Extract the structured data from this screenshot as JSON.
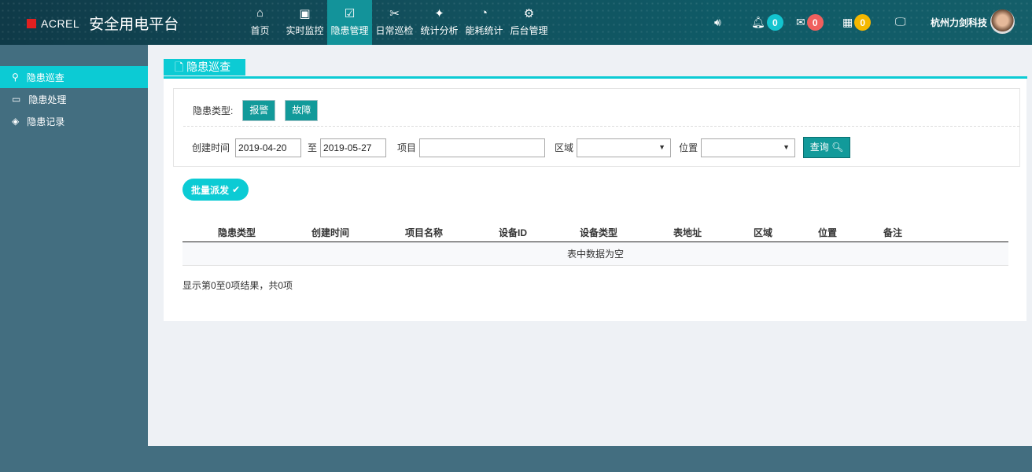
{
  "header": {
    "brand": "ACREL",
    "title": "安全用电平台",
    "nav": [
      {
        "label": "首页",
        "icon": "⌂"
      },
      {
        "label": "实时监控",
        "icon": "▣"
      },
      {
        "label": "隐患管理",
        "icon": "☑",
        "active": true
      },
      {
        "label": "日常巡检",
        "icon": "✂"
      },
      {
        "label": "统计分析",
        "icon": "✦"
      },
      {
        "label": "能耗统计",
        "icon": "◔"
      },
      {
        "label": "后台管理",
        "icon": "⚙"
      }
    ],
    "badges": {
      "bell": "0",
      "mail": "0",
      "calc": "0"
    },
    "badge_colors": {
      "bell": "#13c4cf",
      "mail": "#f0605e",
      "calc": "#f5b800"
    },
    "user": "杭州力剑科技"
  },
  "sidebar": {
    "items": [
      {
        "label": "隐患巡查",
        "icon": "⚲",
        "active": true
      },
      {
        "label": "隐患处理",
        "icon": "▭"
      },
      {
        "label": "隐患记录",
        "icon": "◈"
      }
    ]
  },
  "main": {
    "tab": "隐患巡查",
    "filter": {
      "type_label": "隐患类型:",
      "type_buttons": [
        "报警",
        "故障"
      ],
      "created_label": "创建时间",
      "date_from": "2019-04-20",
      "to_label": "至",
      "date_to": "2019-05-27",
      "project_label": "项目",
      "project_value": "",
      "area_label": "区域",
      "area_value": "",
      "position_label": "位置",
      "position_value": "",
      "query_label": "查询"
    },
    "batch_label": "批量派发",
    "table": {
      "headers": [
        "隐患类型",
        "创建时间",
        "项目名称",
        "设备ID",
        "设备类型",
        "表地址",
        "区域",
        "位置",
        "备注"
      ],
      "empty": "表中数据为空"
    },
    "info": "显示第0至0项结果，共0项"
  }
}
